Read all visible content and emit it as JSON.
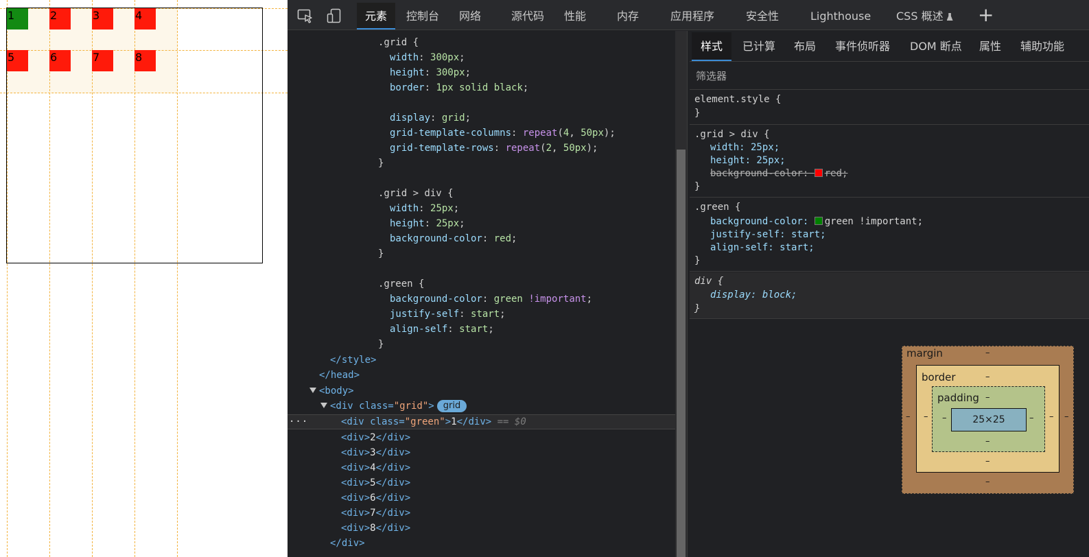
{
  "preview": {
    "cells": [
      {
        "label": "1",
        "green": true
      },
      {
        "label": "2",
        "green": false
      },
      {
        "label": "3",
        "green": false
      },
      {
        "label": "4",
        "green": false
      },
      {
        "label": "5",
        "green": false
      },
      {
        "label": "6",
        "green": false
      },
      {
        "label": "7",
        "green": false
      },
      {
        "label": "8",
        "green": false
      }
    ]
  },
  "toolbar": {
    "inspect_icon": "inspect-element-icon",
    "device_icon": "device-toolbar-icon",
    "tabs": [
      {
        "label": "元素",
        "active": true
      },
      {
        "label": "控制台"
      },
      {
        "label": "网络"
      },
      {
        "label": "源代码"
      },
      {
        "label": "性能"
      },
      {
        "label": "内存"
      },
      {
        "label": "应用程序"
      },
      {
        "label": "安全性"
      },
      {
        "label": "Lighthouse"
      },
      {
        "label": "CSS 概述"
      }
    ],
    "add_tab": "+"
  },
  "elements": {
    "css_lines": {
      "grid_sel": ".grid {",
      "g_width": [
        "width",
        "300px"
      ],
      "g_height": [
        "height",
        "300px"
      ],
      "g_border": [
        "border",
        "1px solid black"
      ],
      "g_display": [
        "display",
        "grid"
      ],
      "g_cols": [
        "grid-template-columns",
        "repeat",
        "4",
        "50px"
      ],
      "g_rows": [
        "grid-template-rows",
        "repeat",
        "2",
        "50px"
      ],
      "close": "}",
      "div_sel": ".grid > div {",
      "d_width": [
        "width",
        "25px"
      ],
      "d_height": [
        "height",
        "25px"
      ],
      "d_bg": [
        "background-color",
        "red"
      ],
      "green_sel": ".green {",
      "gr_bg": [
        "background-color",
        "green",
        "!important"
      ],
      "gr_js": [
        "justify-self",
        "start"
      ],
      "gr_as": [
        "align-self",
        "start"
      ]
    },
    "html": {
      "style_close": "</style>",
      "head_close": "</head>",
      "body_open": "<body>",
      "grid_div_open": "<div class=",
      "grid_class": "\"grid\"",
      "badge": "grid",
      "selected_open": "<div class=",
      "selected_class": "\"green\"",
      "selected_text": "1",
      "selected_close": "</div>",
      "selected_hint": "== $0",
      "ellipsis": "···",
      "children": [
        "2",
        "3",
        "4",
        "5",
        "6",
        "7",
        "8"
      ],
      "div_close": "</div>"
    }
  },
  "styles_pane": {
    "tabs": [
      {
        "label": "样式",
        "active": true
      },
      {
        "label": "已计算"
      },
      {
        "label": "布局"
      },
      {
        "label": "事件侦听器"
      },
      {
        "label": "DOM 断点"
      },
      {
        "label": "属性"
      },
      {
        "label": "辅助功能"
      }
    ],
    "filter_placeholder": "筛选器",
    "rules": {
      "element_style": "element.style {",
      "close": "}",
      "r1_sel": ".grid > div {",
      "r1_width": "width: 25px;",
      "r1_height": "height: 25px;",
      "r1_bg_prop": "background-color: ",
      "r1_bg_val": "red;",
      "r2_sel": ".green {",
      "r2_bg_prop": "background-color: ",
      "r2_bg_val": "green !important;",
      "r2_js": "justify-self: start;",
      "r2_as": "align-self: start;",
      "ua_sel": "div {",
      "ua_display": "display: block;"
    },
    "colors": {
      "red": "#ff0000",
      "green": "#008000"
    },
    "box_model": {
      "margin": "margin",
      "border": "border",
      "padding": "padding",
      "content": "25×25",
      "dash": "–"
    }
  }
}
